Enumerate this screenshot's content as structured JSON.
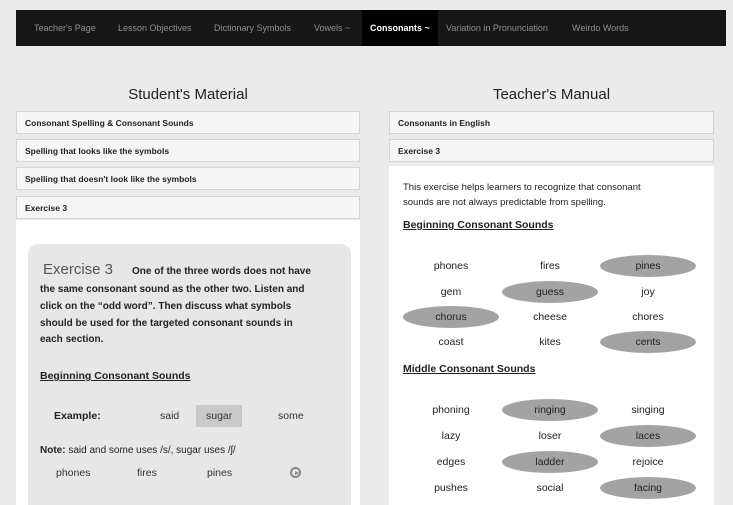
{
  "nav": {
    "items": [
      "Teacher's Page",
      "Lesson Objectives",
      "Dictionary Symbols",
      "Vowels ~",
      "Consonants ~",
      "Variation in Pronunciation",
      "Weirdo Words"
    ],
    "active_index": 4
  },
  "student": {
    "title": "Student's Material",
    "accordion": [
      "Consonant Spelling & Consonant Sounds",
      "Spelling that looks like the symbols",
      "Spelling that doesn't look like the symbols",
      "Exercise 3"
    ],
    "exercise": {
      "heading": "Exercise 3",
      "instructions": [
        "One of the three words does not have",
        "the same consonant sound as the other two. Listen and",
        "click on the “odd word”. Then discuss what symbols",
        "should be used for the targeted consonant sounds in",
        "each section."
      ],
      "section": "Beginning Consonant Sounds",
      "example_label": "Example:",
      "example_words": [
        "said",
        "sugar",
        "some"
      ],
      "example_selected": 1,
      "note_label": "Note:",
      "note_text": "said and some uses /s/, sugar uses /ʃ/",
      "row_words": [
        "phones",
        "fires",
        "pines"
      ]
    }
  },
  "teacher": {
    "title": "Teacher's Manual",
    "accordion": [
      "Consonants in English",
      "Exercise 3"
    ],
    "intro": [
      "This exercise helps learners to recognize that consonant",
      "sounds are not always predictable from spelling."
    ],
    "sections": [
      {
        "title": "Beginning Consonant Sounds",
        "rows": [
          {
            "words": [
              "phones",
              "fires",
              "pines"
            ],
            "selected": 2
          },
          {
            "words": [
              "gem",
              "guess",
              "joy"
            ],
            "selected": 1
          },
          {
            "words": [
              "chorus",
              "cheese",
              "chores"
            ],
            "selected": 0
          },
          {
            "words": [
              "coast",
              "kites",
              "cents"
            ],
            "selected": 2
          }
        ]
      },
      {
        "title": "Middle Consonant Sounds",
        "rows": [
          {
            "words": [
              "phoning",
              "ringing",
              "singing"
            ],
            "selected": 1
          },
          {
            "words": [
              "lazy",
              "loser",
              "laces"
            ],
            "selected": 2
          },
          {
            "words": [
              "edges",
              "ladder",
              "rejoice"
            ],
            "selected": 1
          },
          {
            "words": [
              "pushes",
              "social",
              "facing"
            ],
            "selected": 2
          }
        ]
      }
    ]
  }
}
